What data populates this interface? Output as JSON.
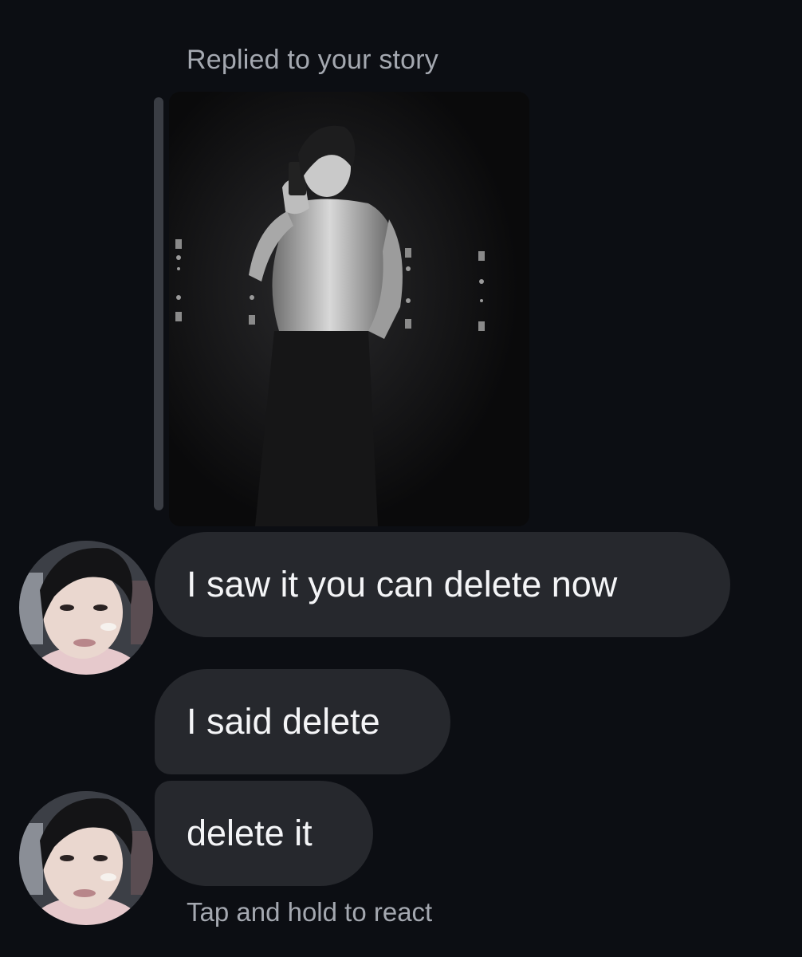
{
  "thread": {
    "reply_context_label": "Replied to your story",
    "story": {
      "image": "black-and-white mirror selfie story photo"
    },
    "messages": [
      {
        "text": "I saw it you can delete now",
        "show_avatar": true
      },
      {
        "text": "I said delete",
        "show_avatar": false
      },
      {
        "text": "delete it",
        "show_avatar": true
      }
    ],
    "react_hint": "Tap and hold to react"
  },
  "colors": {
    "background": "#0c0e13",
    "bubble": "#26282d",
    "secondary_text": "#a4a8b0",
    "reply_bar": "#3a3d44"
  }
}
